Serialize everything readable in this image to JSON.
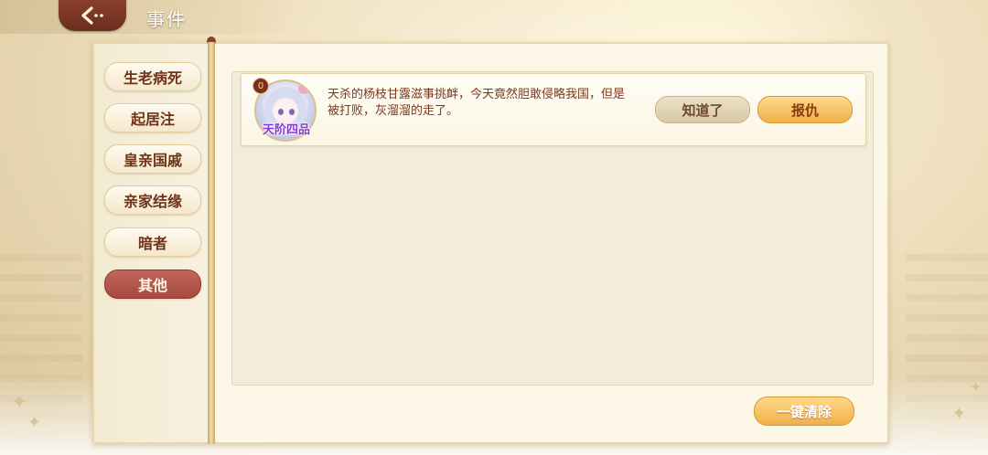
{
  "header": {
    "title": "事件",
    "back_icon": "back-arrow-icon"
  },
  "sidebar": {
    "tabs": [
      {
        "label": "生老病死",
        "active": false
      },
      {
        "label": "起居注",
        "active": false
      },
      {
        "label": "皇亲国戚",
        "active": false
      },
      {
        "label": "亲家结缘",
        "active": false
      },
      {
        "label": "暗者",
        "active": false
      },
      {
        "label": "其他",
        "active": true
      }
    ]
  },
  "events": [
    {
      "level": "0",
      "rank": "天阶四品",
      "text": "天杀的杨枝甘露滋事挑衅，今天竟然胆敢侵略我国，但是被打败，灰溜溜的走了。",
      "dismiss_label": "知道了",
      "revenge_label": "报仇"
    }
  ],
  "footer": {
    "clear_label": "一键清除"
  },
  "colors": {
    "accent": "#f0b04a",
    "active_tab": "#a74a40",
    "text": "#7a3a1e"
  }
}
